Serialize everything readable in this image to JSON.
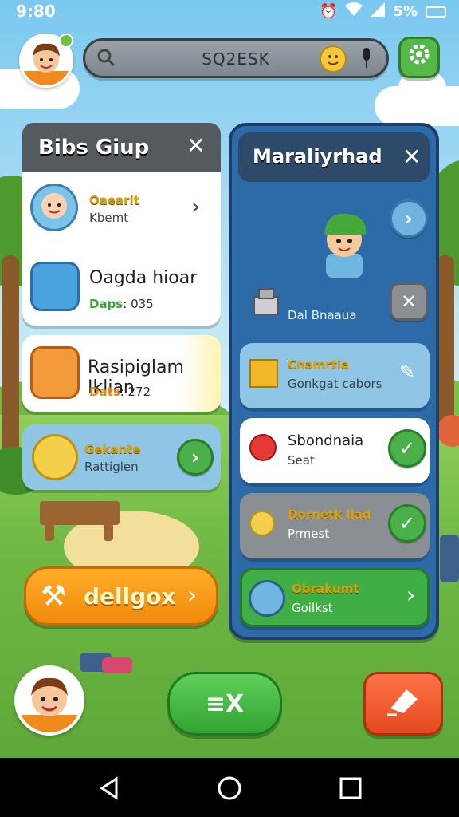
{
  "status_bar": {
    "time": "9:80",
    "battery": "5%"
  },
  "top_bar": {
    "search_text": "SQ2ESK"
  },
  "left_panel": {
    "title": "Bibs Giup",
    "cards": [
      {
        "title": "Oaearit",
        "subtitle": "Kbemt"
      },
      {
        "title": "Oagda hioar",
        "meta_label": "Daps",
        "meta_value": ": 035"
      },
      {
        "title": "Rasipiglam Iklian",
        "meta_label": "Dats",
        "meta_value": ": 272"
      },
      {
        "title": "Gekante",
        "subtitle": "Rattiglen"
      }
    ]
  },
  "right_panel": {
    "title": "Maraliyrhad",
    "row_text": "Dal Bnaaua",
    "items": [
      {
        "title": "Cnamrtia",
        "subtitle": "Gonkgat cabors"
      },
      {
        "title": "Sbondnaia",
        "subtitle": "Seat"
      },
      {
        "title": "Dornetk llad",
        "subtitle": "Prmest"
      },
      {
        "title": "Obrakumt",
        "subtitle": "Goilkst"
      }
    ]
  },
  "bottom": {
    "cta_label": "dellgox",
    "menu_label": "≡X"
  },
  "colors": {
    "accent_orange": "#f08a0c",
    "accent_green": "#33a32f",
    "panel_blue": "#2d6aa8",
    "accent_red": "#e44a20"
  }
}
